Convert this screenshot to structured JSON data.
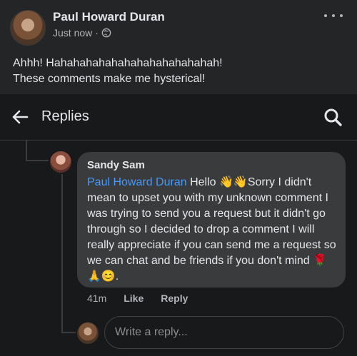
{
  "post": {
    "author": "Paul Howard Duran",
    "time": "Just now",
    "text_line1": "Ahhh! Hahahahahahahahahahahahahah!",
    "text_line2": "These comments make me hysterical!"
  },
  "replies_header": {
    "title": "Replies"
  },
  "comment": {
    "author": "Sandy Sam",
    "mention": "Paul Howard Duran",
    "text": "Hello 👋👋Sorry I didn't mean to upset you with my unknown comment I was trying to send you a request but it didn't go through so I decided to drop a comment I will really appreciate if you can send me a request so we can chat and be friends if you don't mind 🌹🙏😊.",
    "time": "41m",
    "like_label": "Like",
    "reply_label": "Reply"
  },
  "reply_box": {
    "placeholder": "Write a reply..."
  },
  "colors": {
    "background": "#18191a",
    "bubble": "#3a3b3c",
    "mention": "#4599ff"
  },
  "icons": [
    "globe-icon",
    "more-options-icon",
    "back-arrow-icon",
    "search-icon"
  ]
}
